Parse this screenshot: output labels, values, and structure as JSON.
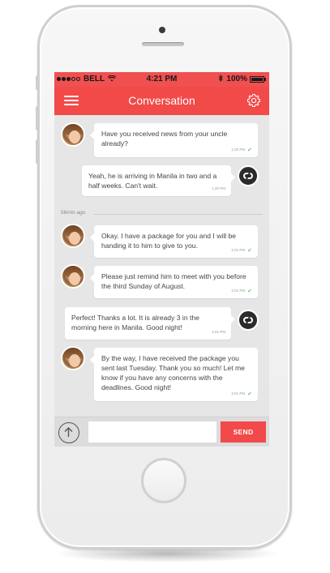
{
  "status_bar": {
    "carrier": "BELL",
    "time": "4:21 PM",
    "battery": "100%"
  },
  "nav": {
    "title": "Conversation",
    "left_icon": "menu-icon",
    "right_icon": "gear-icon"
  },
  "messages": [
    {
      "sender": "contact",
      "text": "Have you received news from your uncle already?",
      "time": "1:20 PM"
    },
    {
      "sender": "me",
      "text": "Yeah, he is arriving in Manila in two and a half weeks. Can't wait.",
      "time": "1:20 PM"
    },
    {
      "sender": "contact",
      "text": "Okay. I have a package for you and I will be handing it to him to give to you.",
      "time": "2:01 PM"
    },
    {
      "sender": "contact",
      "text": "Please just remind him to meet with you before the third Sunday of August.",
      "time": "2:01 PM"
    },
    {
      "sender": "me",
      "text": "Perfect! Thanks a lot. It is already 3 in the morning here in Manila. Good night!",
      "time": "2:01 PM"
    },
    {
      "sender": "contact",
      "text": "By the way, I have received the package you sent last Tuesday. Thank you so much! Let me know if you have any concerns with the deadlines. Good night!",
      "time": "2:01 PM"
    }
  ],
  "divider_label": "56min ago",
  "composer": {
    "input_value": "",
    "input_placeholder": "",
    "send_label": "SEND",
    "upload_icon": "arrow-up-icon"
  },
  "colors": {
    "accent": "#f24949",
    "screen_bg": "#e6e6e6",
    "read_check": "#6ccf6c"
  }
}
